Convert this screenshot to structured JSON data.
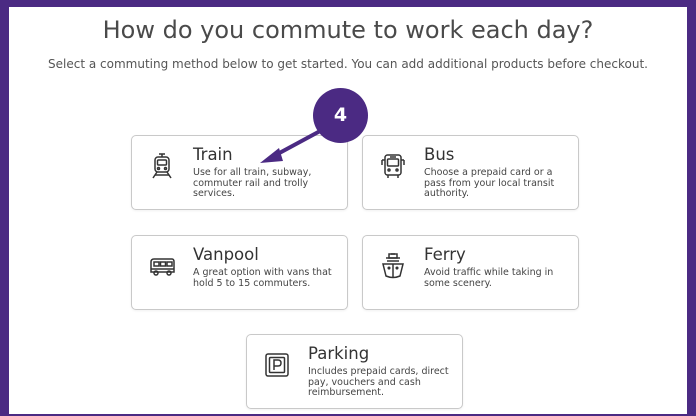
{
  "page": {
    "title": "How do you commute to work each day?",
    "subtitle": "Select a commuting method below to get started. You can add additional products before checkout."
  },
  "step_badge": "4",
  "cards": [
    {
      "title": "Train",
      "description": "Use for all train, subway, commuter rail and trolly services.",
      "icon": "train-icon"
    },
    {
      "title": "Bus",
      "description": "Choose a prepaid card or a pass from your local transit authority.",
      "icon": "bus-icon"
    },
    {
      "title": "Vanpool",
      "description": "A great option with vans that hold 5 to 15 commuters.",
      "icon": "van-icon"
    },
    {
      "title": "Ferry",
      "description": "Avoid traffic while taking in some scenery.",
      "icon": "ferry-icon"
    },
    {
      "title": "Parking",
      "description": "Includes prepaid cards, direct pay, vouchers and cash reimbursement.",
      "icon": "parking-icon"
    }
  ],
  "colors": {
    "accent": "#4b2a83",
    "card_border": "#c9c9c9"
  }
}
